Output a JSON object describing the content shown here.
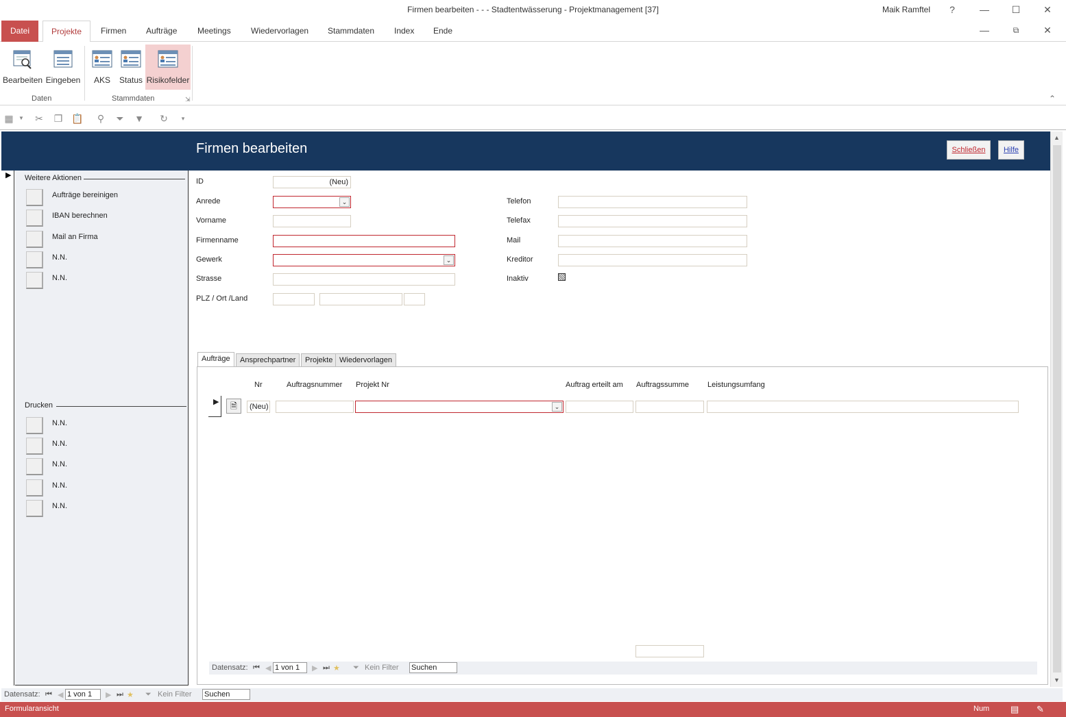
{
  "window": {
    "title": "Firmen bearbeiten -  -  - Stadtentwässerung - Projektmanagement [37]",
    "user": "Maik Ramftel",
    "help": "?"
  },
  "ribbon": {
    "tabs": [
      "Datei",
      "Projekte",
      "Firmen",
      "Aufträge",
      "Meetings",
      "Wiedervorlagen",
      "Stammdaten",
      "Index",
      "Ende"
    ],
    "buttons": {
      "bearbeiten": "Bearbeiten",
      "eingeben": "Eingeben",
      "aks": "AKS",
      "status": "Status",
      "risikofelder": "Risikofelder"
    },
    "groups": {
      "daten": "Daten",
      "stammdaten": "Stammdaten"
    }
  },
  "form": {
    "title": "Firmen bearbeiten",
    "close_label": "Schließen",
    "help_label": "Hilfe",
    "accent_color": "#17375e"
  },
  "left_panel": {
    "actions_title": "Weitere Aktionen",
    "actions": [
      "Aufträge bereinigen",
      "IBAN berechnen",
      "Mail an Firma",
      "N.N.",
      "N.N."
    ],
    "print_title": "Drucken",
    "print_items": [
      "N.N.",
      "N.N.",
      "N.N.",
      "N.N.",
      "N.N."
    ]
  },
  "fields": {
    "id_label": "ID",
    "id_value": "(Neu)",
    "anrede_label": "Anrede",
    "vorname_label": "Vorname",
    "firmenname_label": "Firmenname",
    "gewerk_label": "Gewerk",
    "strasse_label": "Strasse",
    "plz_label": "PLZ / Ort /Land",
    "telefon_label": "Telefon",
    "telefax_label": "Telefax",
    "mail_label": "Mail",
    "kreditor_label": "Kreditor",
    "inaktiv_label": "Inaktiv"
  },
  "subform": {
    "tabs": [
      "Aufträge",
      "Ansprechpartner",
      "Projekte",
      "Wiedervorlagen"
    ],
    "columns": {
      "nr": "Nr",
      "auftragsnummer": "Auftragsnummer",
      "projekt_nr": "Projekt Nr",
      "erteilt": "Auftrag erteilt am",
      "summe": "Auftragssumme",
      "leistung": "Leistungsumfang"
    },
    "row": {
      "nr": "(Neu)"
    },
    "nav": {
      "label": "Datensatz:",
      "record": "1 von 1",
      "filter": "Kein Filter",
      "search": "Suchen"
    }
  },
  "main_nav": {
    "label": "Datensatz:",
    "record": "1 von 1",
    "filter": "Kein Filter",
    "search": "Suchen"
  },
  "statusbar": {
    "left": "Formularansicht",
    "num": "Num"
  }
}
